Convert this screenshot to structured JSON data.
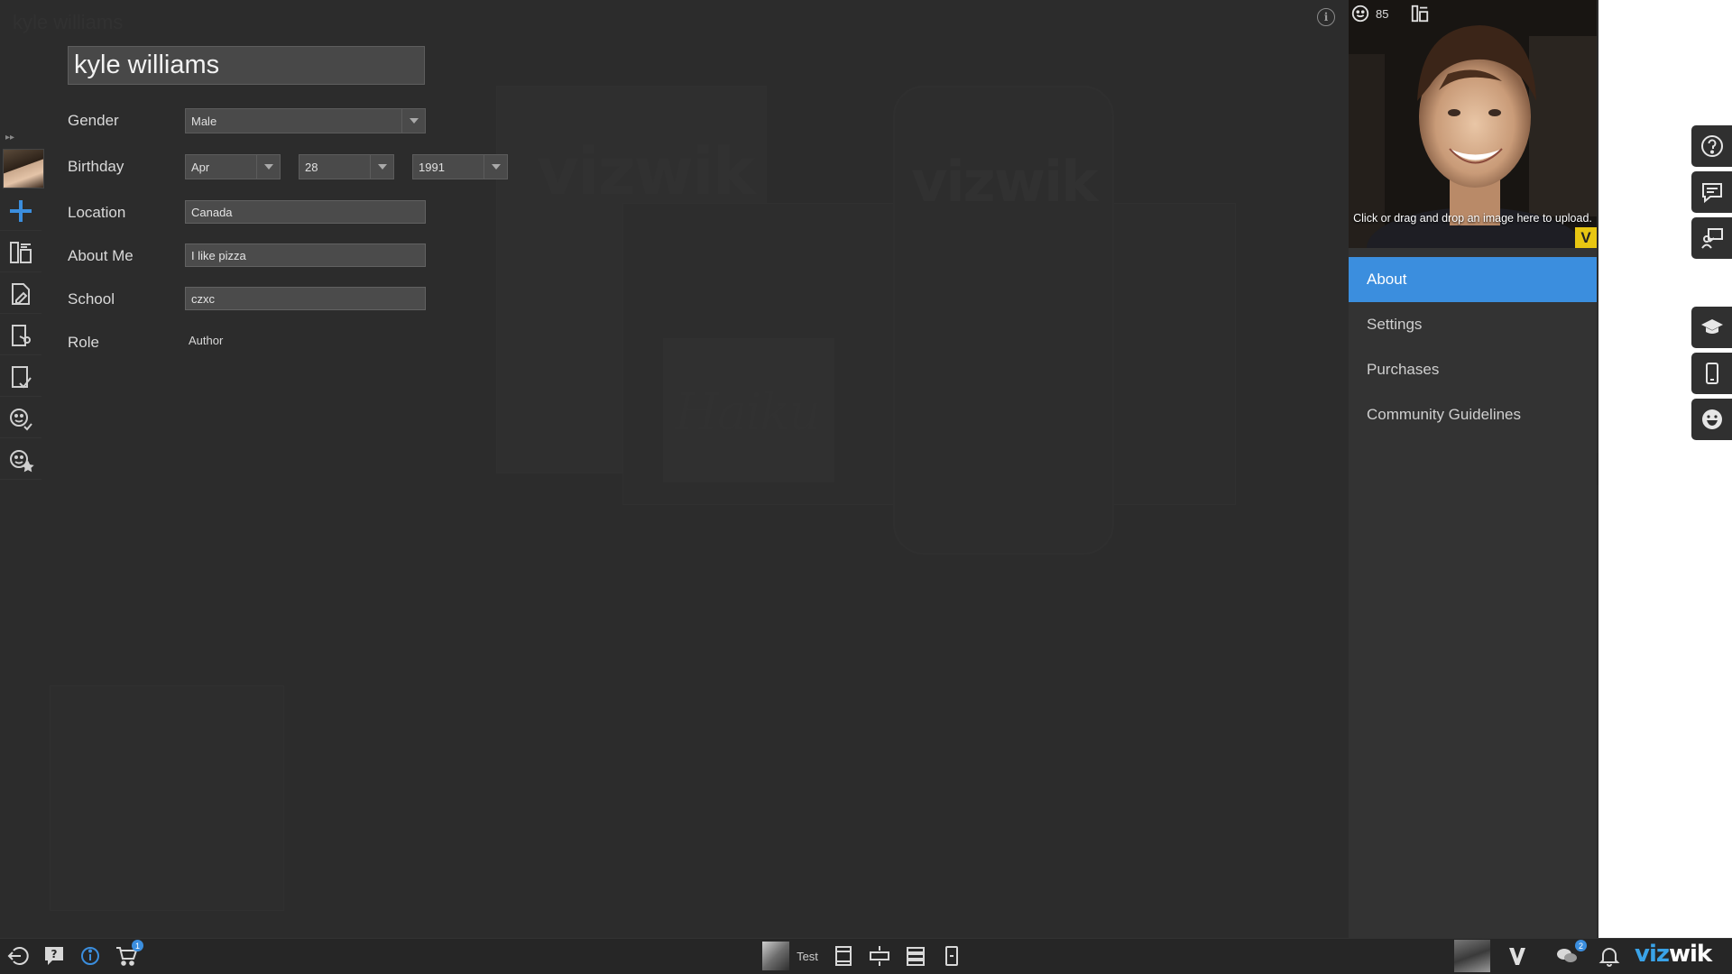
{
  "window": {
    "background_title": "kyle williams"
  },
  "profile": {
    "name": "kyle williams",
    "labels": {
      "gender": "Gender",
      "birthday": "Birthday",
      "location": "Location",
      "about_me": "About Me",
      "school": "School",
      "role": "Role"
    },
    "gender": "Male",
    "birthday": {
      "month": "Apr",
      "day": "28",
      "year": "1991"
    },
    "location": "Canada",
    "about_me": "I like pizza",
    "school": "czxc",
    "role": "Author"
  },
  "side_panel": {
    "counter": "85",
    "photo_hint": "Click or drag and drop an image here to upload.",
    "badge": "V",
    "tabs": [
      {
        "label": "About",
        "active": true
      },
      {
        "label": "Settings",
        "active": false
      },
      {
        "label": "Purchases",
        "active": false
      },
      {
        "label": "Community Guidelines",
        "active": false
      }
    ],
    "close": "✕"
  },
  "ghost_canvas": {
    "logo_text": "vizwik",
    "haiku_text": "Haiku"
  },
  "bottom_bar": {
    "cart_count": "1",
    "project_label": "Test",
    "chat_count": "2",
    "brand_prefix": "viz",
    "brand_suffix": "wik"
  },
  "colors": {
    "accent": "#3b8ede",
    "background": "#2c2c2c",
    "badge_yellow": "#e8c612"
  }
}
